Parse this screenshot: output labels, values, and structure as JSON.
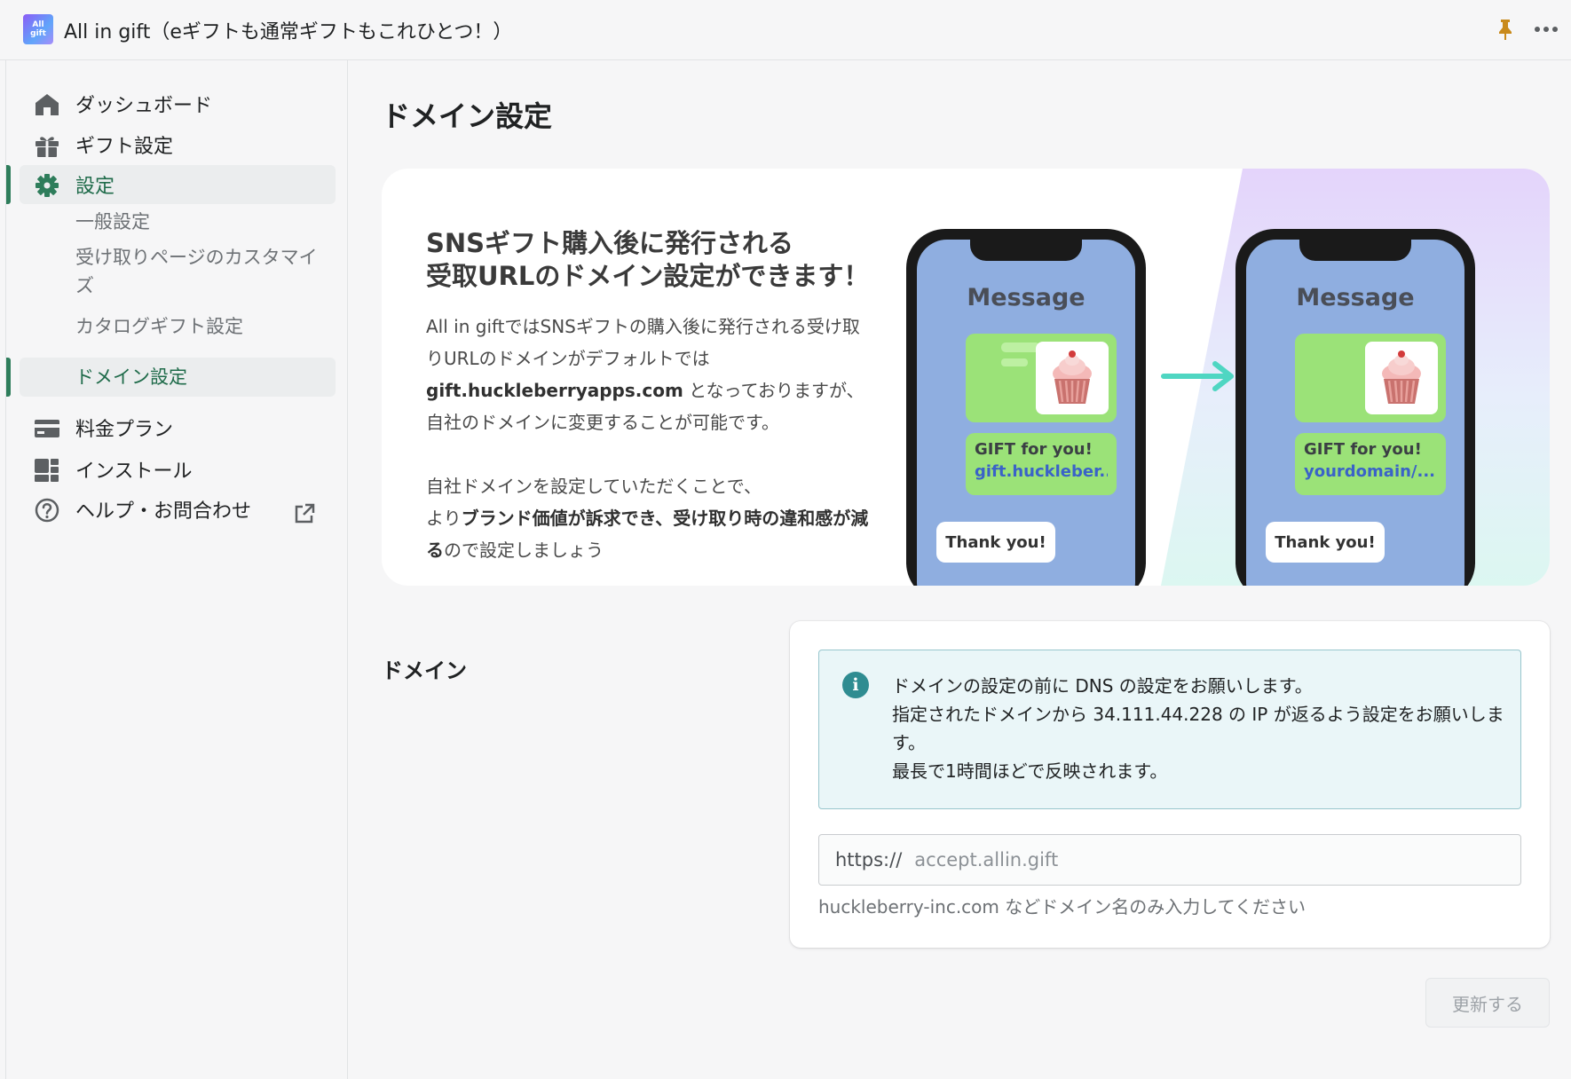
{
  "app": {
    "title": "All in gift（eギフトも通常ギフトもこれひとつ！）",
    "logo_line1": "All",
    "logo_line2": "gift"
  },
  "sidebar": {
    "items": [
      {
        "label": "ダッシュボード",
        "icon": "home-icon"
      },
      {
        "label": "ギフト設定",
        "icon": "gift-icon"
      },
      {
        "label": "設定",
        "icon": "gear-icon"
      },
      {
        "label": "料金プラン",
        "icon": "credit-card-icon"
      },
      {
        "label": "インストール",
        "icon": "apps-icon"
      },
      {
        "label": "ヘルプ・お問合わせ",
        "icon": "help-icon"
      }
    ],
    "sub_items": [
      {
        "label": "一般設定"
      },
      {
        "label": "受け取りページのカスタマイズ"
      },
      {
        "label": "カタログギフト設定"
      },
      {
        "label": "ドメイン設定"
      }
    ],
    "active_item": "設定",
    "active_sub_item": "ドメイン設定"
  },
  "page": {
    "title": "ドメイン設定"
  },
  "banner": {
    "heading_line1": "SNSギフト購入後に発行される",
    "heading_line2": "受取URLのドメイン設定ができます！",
    "body_line1": "All in giftではSNSギフトの購入後に発行される受け取りURLのドメインがデフォルトでは",
    "body_domain": "gift.huckleberryapps.com",
    "body_line2": " となっておりますが、自社のドメインに変更することが可能です。",
    "body_line3": "自社ドメインを設定していただくことで、",
    "body_line4_pre": "より",
    "body_line4_bold": "ブランド価値が訴求でき、受け取り時の違和感が減る",
    "body_line4_post": "ので設定しましょう",
    "phone_before": {
      "title": "Message",
      "gift_label": "GIFT for you!",
      "gift_url": "gift.huckleber...",
      "thanks": "Thank you!"
    },
    "phone_after": {
      "title": "Message",
      "gift_label": "GIFT for you!",
      "gift_url": "yourdomain/...",
      "thanks": "Thank you!"
    }
  },
  "domain_section": {
    "label": "ドメイン",
    "info_line1": "ドメインの設定の前に DNS の設定をお願いします。",
    "info_line2": "指定されたドメインから 34.111.44.228 の IP が返るよう設定をお願いします。",
    "info_line3": "最長で1時間ほどで反映されます。",
    "url_prefix": "https://",
    "url_value": "",
    "url_placeholder": "accept.allin.gift",
    "help_text": "huckleberry-inc.com などドメイン名のみ入力してください"
  },
  "actions": {
    "update_label": "更新する"
  },
  "colors": {
    "accent": "#2e7d5b",
    "info_bg": "#eaf6f8",
    "info_border": "#98c6cd",
    "phone_screen": "#8faee0",
    "bubble_green": "#9be278",
    "arrow": "#4fd6c2"
  }
}
